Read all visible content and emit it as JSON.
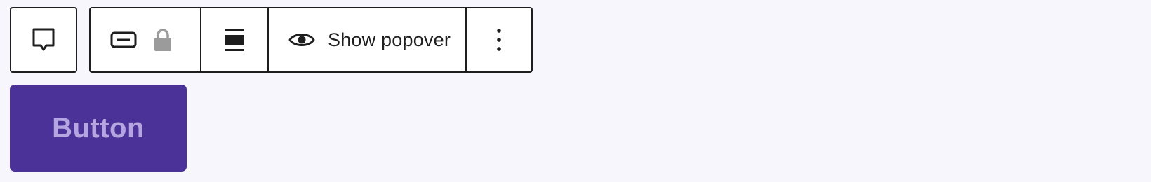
{
  "toolbar": {
    "comment_icon": "comment-bubble-icon",
    "block_icon": "button-block-icon",
    "lock_icon": "lock-icon",
    "align_icon": "align-justify-icon",
    "popover_icon": "eye-icon",
    "popover_label": "Show popover",
    "more_icon": "vertical-ellipsis-icon"
  },
  "main": {
    "button_label": "Button"
  },
  "colors": {
    "background": "#f7f6fd",
    "toolbar_border": "#1e1e1e",
    "primary_button": "#4a3299",
    "primary_button_text": "#b6a6e0",
    "lock_grey": "#9b9b9b"
  }
}
